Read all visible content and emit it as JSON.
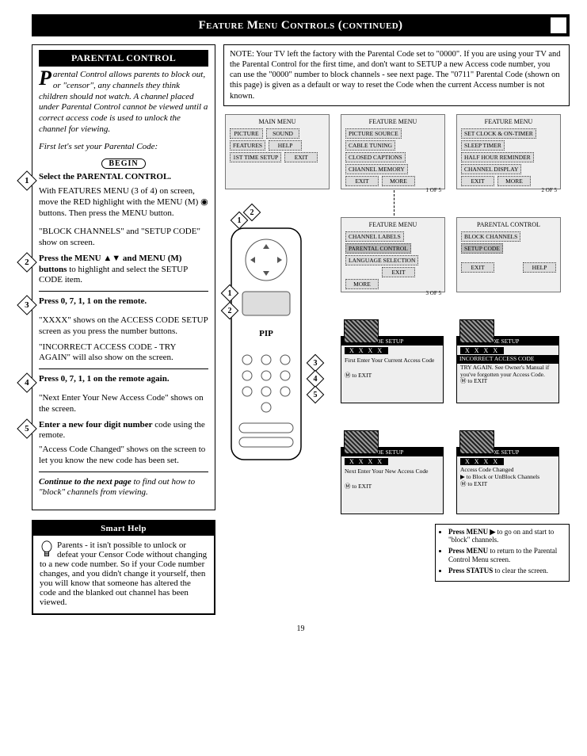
{
  "header": {
    "title_main": "Feature Menu Controls (continued)"
  },
  "parental": {
    "header": "PARENTAL CONTROL",
    "intro_dropcap": "P",
    "intro_text": "arental Control allows parents to block out, or \"censor\", any channels they think children should not watch. A channel placed under Parental Control cannot be viewed until a correct access code is used to unlock the channel for viewing.",
    "first_line": "First let's set your Parental Code:",
    "begin_label": "BEGIN",
    "step1_lead": "Select the PARENTAL CONTROL.",
    "step1_body": "With FEATURES MENU (3 of 4) on screen, move the RED highlight with the MENU (M) ◉ buttons. Then press the MENU button.",
    "p_block": "\"BLOCK CHANNELS\" and \"SETUP CODE\" show on screen.",
    "step2_lead": "Press the MENU ▲▼ and MENU (M) buttons",
    "step2_tail": " to highlight and select the SETUP CODE item.",
    "step3_lead": "Press 0, 7, 1, 1 on the remote.",
    "p_xxxx": "\"XXXX\" shows on the ACCESS CODE SETUP screen as you press the number buttons.",
    "p_incorrect": "\"INCORRECT ACCESS CODE - TRY AGAIN\" will also show on the screen.",
    "step4_lead": "Press 0, 7, 1, 1 on the remote again.",
    "p_next": "\"Next Enter Your New Access Code\" shows on the screen.",
    "step5_lead": "Enter a new four digit number",
    "step5_tail": " code using the remote.",
    "p_changed": "\"Access Code Changed\" shows on the screen to let you know the new code has been set.",
    "continue": "Continue to the next page",
    "continue_tail": " to find out how to \"block\" channels from viewing."
  },
  "smart": {
    "header": "Smart Help",
    "body": "Parents - it isn't possible to unlock or defeat your Censor Code without changing to a new code number. So if your Code number changes, and you didn't change it yourself, then you will know that someone has altered the code and the blanked out channel has been viewed."
  },
  "note": {
    "text": "NOTE: Your TV left the factory with the Parental Code set to \"0000\". If you are using your TV and the Parental Control for the first time, and don't want to SETUP a new Access code number, you can use the \"0000\" number to block channels - see next page. The \"0711\" Parental Code (shown on this page) is given as a default or way to reset the Code when the current Access number is not known."
  },
  "screens": {
    "main_menu": {
      "title": "MAIN MENU",
      "b1": "PICTURE",
      "b2": "SOUND",
      "b3": "FEATURES",
      "b4": "HELP",
      "b5": "1ST TIME SETUP",
      "b6": "EXIT"
    },
    "feat1": {
      "title": "FEATURE MENU",
      "b1": "PICTURE SOURCE",
      "b2": "CABLE TUNING",
      "b3": "CLOSED CAPTIONS",
      "b4": "CHANNEL MEMORY",
      "b5": "EXIT",
      "b6": "MORE",
      "pager": "1 OF 5"
    },
    "feat2": {
      "title": "FEATURE MENU",
      "b1": "SET CLOCK & ON-TIMER",
      "b2": "SLEEP TIMER",
      "b3": "HALF HOUR REMINDER",
      "b4": "CHANNEL DISPLAY",
      "b5": "EXIT",
      "b6": "MORE",
      "pager": "2 OF 5"
    },
    "feat3": {
      "title": "FEATURE MENU",
      "b1": "CHANNEL LABELS",
      "b2": "PARENTAL CONTROL",
      "b3": "LANGUAGE SELECTION",
      "b5": "EXIT",
      "b6": "MORE",
      "pager": "3 OF 5"
    },
    "pc": {
      "title": "PARENTAL CONTROL",
      "b1": "BLOCK CHANNELS",
      "b2": "SETUP CODE",
      "b5": "EXIT",
      "b6": "HELP"
    }
  },
  "access_screens": {
    "s1": {
      "hdr": "ACCESS CODE SETUP",
      "xxxx": "X X X X",
      "body": "First Enter Your Current Access Code",
      "exit": "to EXIT"
    },
    "s2": {
      "hdr": "ACCESS CODE SETUP",
      "xxxx": "X X X X",
      "hdr2": "INCORRECT ACCESS CODE",
      "body": "TRY AGAIN. See Owner's Manual if you've forgotten your Access Code.",
      "exit": "to EXIT"
    },
    "s3": {
      "hdr": "ACCESS CODE SETUP",
      "xxxx": "X X X X",
      "body": "Next Enter Your New Access Code",
      "exit": "to EXIT"
    },
    "s4": {
      "hdr": "ACCESS CODE SETUP",
      "xxxx": "X X X X",
      "body": "Access Code Changed",
      "block": "to Block or UnBlock Channels",
      "exit": "to EXIT"
    }
  },
  "tips": {
    "t1a": "Press MENU ▶",
    "t1b": " to go on and start to \"block\" channels.",
    "t2a": "Press MENU",
    "t2b": " to return to the Parental Control Menu screen.",
    "t3a": "Press STATUS",
    "t3b": " to clear the screen."
  },
  "page_num": "19",
  "remote": {
    "pip_label": "PIP"
  }
}
